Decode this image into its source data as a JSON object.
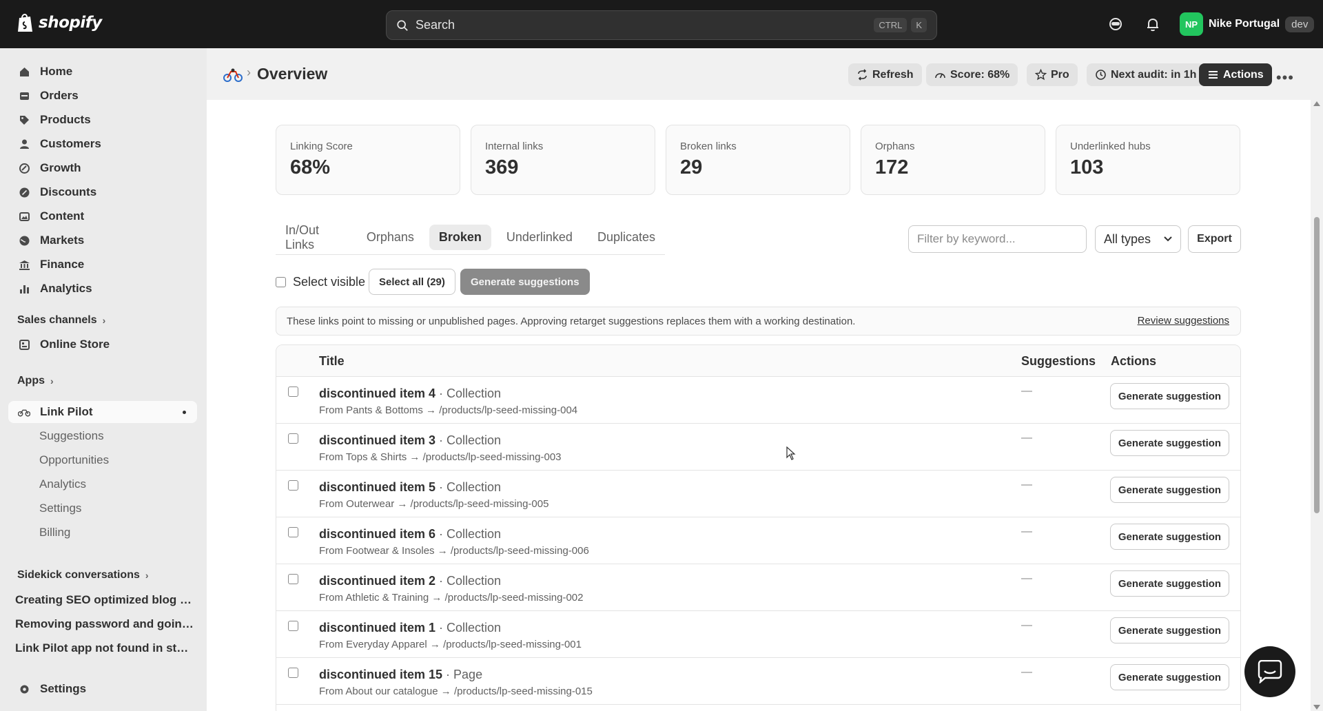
{
  "topbar": {
    "logo_text": "shopify",
    "search_placeholder": "Search",
    "shortcut_ctrl": "CTRL",
    "shortcut_k": "K",
    "user_initials": "NP",
    "store_name": "Nike Portugal",
    "env_badge": "dev",
    "avatar_color": "#22c55e"
  },
  "sidebar": {
    "items": [
      {
        "label": "Home",
        "icon": "home-icon"
      },
      {
        "label": "Orders",
        "icon": "orders-icon"
      },
      {
        "label": "Products",
        "icon": "tag-icon"
      },
      {
        "label": "Customers",
        "icon": "person-icon"
      },
      {
        "label": "Growth",
        "icon": "growth-icon"
      },
      {
        "label": "Discounts",
        "icon": "discount-icon"
      },
      {
        "label": "Content",
        "icon": "content-icon"
      },
      {
        "label": "Markets",
        "icon": "globe-icon"
      },
      {
        "label": "Finance",
        "icon": "bank-icon"
      },
      {
        "label": "Analytics",
        "icon": "bar-chart-icon"
      }
    ],
    "sales_channels_label": "Sales channels",
    "online_store_label": "Online Store",
    "apps_label": "Apps",
    "app_name": "Link Pilot",
    "app_subitems": [
      "Suggestions",
      "Opportunities",
      "Analytics",
      "Settings",
      "Billing"
    ],
    "sidekick_label": "Sidekick conversations",
    "conversations": [
      "Creating SEO optimized blog p...",
      "Removing password and going...",
      "Link Pilot app not found in store"
    ],
    "settings_label": "Settings"
  },
  "header": {
    "title": "Overview",
    "refresh": "Refresh",
    "score": "Score: 68%",
    "pro": "Pro",
    "next_audit": "Next audit: in 1h",
    "actions": "Actions"
  },
  "metrics": [
    {
      "label": "Linking Score",
      "value": "68%"
    },
    {
      "label": "Internal links",
      "value": "369"
    },
    {
      "label": "Broken links",
      "value": "29"
    },
    {
      "label": "Orphans",
      "value": "172"
    },
    {
      "label": "Underlinked hubs",
      "value": "103"
    }
  ],
  "tabs": [
    "In/Out Links",
    "Orphans",
    "Broken",
    "Underlinked",
    "Duplicates"
  ],
  "active_tab": "Broken",
  "filter": {
    "placeholder": "Filter by keyword...",
    "type_selected": "All types",
    "export": "Export"
  },
  "selection": {
    "select_visible": "Select visible",
    "select_all": "Select all (29)",
    "generate": "Generate suggestions"
  },
  "info": {
    "text": "These links point to missing or unpublished pages. Approving retarget suggestions replaces them with a working destination.",
    "link": "Review suggestions"
  },
  "table": {
    "headers": {
      "title": "Title",
      "suggestions": "Suggestions",
      "actions": "Actions"
    },
    "rows": [
      {
        "title": "discontinued item 4",
        "type": " · Collection",
        "from": "From Pants & Bottoms → /products/lp-seed-missing-004",
        "suggestion": "—",
        "action": "Generate suggestion"
      },
      {
        "title": "discontinued item 3",
        "type": " · Collection",
        "from": "From Tops & Shirts → /products/lp-seed-missing-003",
        "suggestion": "—",
        "action": "Generate suggestion"
      },
      {
        "title": "discontinued item 5",
        "type": " · Collection",
        "from": "From Outerwear → /products/lp-seed-missing-005",
        "suggestion": "—",
        "action": "Generate suggestion"
      },
      {
        "title": "discontinued item 6",
        "type": " · Collection",
        "from": "From Footwear & Insoles → /products/lp-seed-missing-006",
        "suggestion": "—",
        "action": "Generate suggestion"
      },
      {
        "title": "discontinued item 2",
        "type": " · Collection",
        "from": "From Athletic & Training → /products/lp-seed-missing-002",
        "suggestion": "—",
        "action": "Generate suggestion"
      },
      {
        "title": "discontinued item 1",
        "type": " · Collection",
        "from": "From Everyday Apparel → /products/lp-seed-missing-001",
        "suggestion": "—",
        "action": "Generate suggestion"
      },
      {
        "title": "discontinued item 15",
        "type": " · Page",
        "from": "From About our catalogue → /products/lp-seed-missing-015",
        "suggestion": "—",
        "action": "Generate suggestion"
      }
    ]
  }
}
